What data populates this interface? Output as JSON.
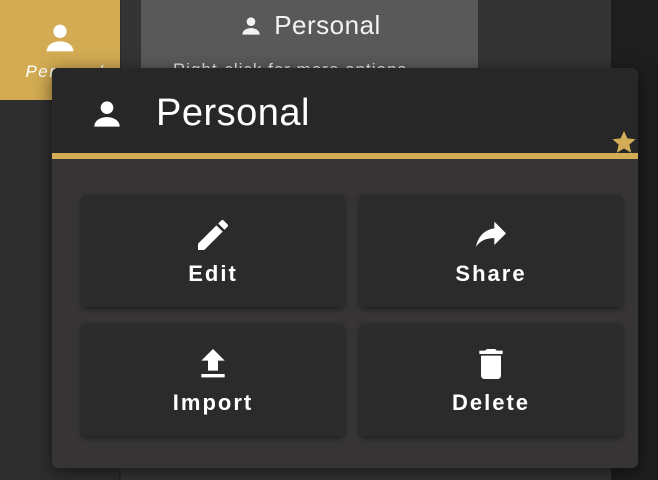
{
  "background": {
    "rail_tile_label": "Personal",
    "tooltip": {
      "title": "Personal",
      "subtitle": "Right-click for more options"
    }
  },
  "popup": {
    "title": "Personal",
    "favorite_icon": "star-icon",
    "actions": [
      {
        "label": "Edit",
        "icon": "pencil-icon"
      },
      {
        "label": "Share",
        "icon": "share-arrow-icon"
      },
      {
        "label": "Import",
        "icon": "upload-icon"
      },
      {
        "label": "Delete",
        "icon": "trash-icon"
      }
    ]
  },
  "colors": {
    "accent": "#d4ac55",
    "rail_tile": "#d2ab52",
    "popup_bg": "#363434",
    "header_bg": "#282727",
    "button_bg": "#2c2b2b"
  }
}
